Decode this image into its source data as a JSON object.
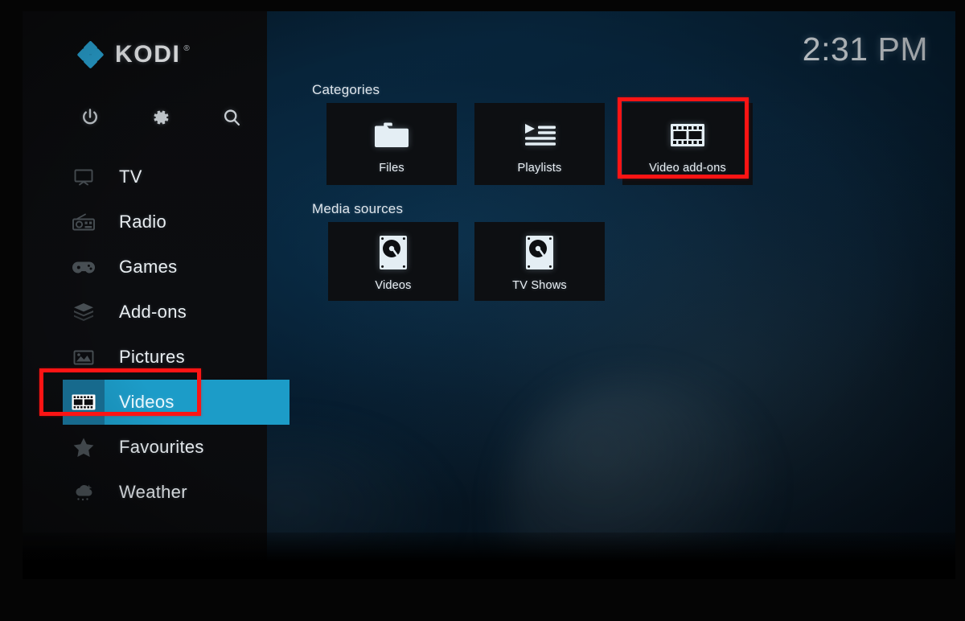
{
  "app": {
    "name": "KODI",
    "trademark": "®",
    "logo_color": "#2aa9db"
  },
  "clock": {
    "time": "2:31 PM"
  },
  "quick_actions": [
    {
      "name": "power-button",
      "icon": "power-icon",
      "label": "Power"
    },
    {
      "name": "settings-button",
      "icon": "gear-icon",
      "label": "Settings"
    },
    {
      "name": "search-button",
      "icon": "search-icon",
      "label": "Search"
    }
  ],
  "sidebar": {
    "items": [
      {
        "label": "TV",
        "icon": "tv-icon",
        "selected": false
      },
      {
        "label": "Radio",
        "icon": "radio-icon",
        "selected": false
      },
      {
        "label": "Games",
        "icon": "gamepad-icon",
        "selected": false
      },
      {
        "label": "Add-ons",
        "icon": "box-icon",
        "selected": false
      },
      {
        "label": "Pictures",
        "icon": "picture-icon",
        "selected": false
      },
      {
        "label": "Videos",
        "icon": "film-strip-icon",
        "selected": true
      },
      {
        "label": "Favourites",
        "icon": "star-icon",
        "selected": false
      },
      {
        "label": "Weather",
        "icon": "cloud-icon",
        "selected": false
      }
    ],
    "selected_index": 5,
    "highlight_color": "#1c9cc8",
    "highlight_icon_color": "#176a8d"
  },
  "main": {
    "categories": {
      "title": "Categories",
      "tiles": [
        {
          "label": "Files",
          "icon": "folder-icon",
          "highlighted": false
        },
        {
          "label": "Playlists",
          "icon": "playlist-icon",
          "highlighted": false
        },
        {
          "label": "Video add-ons",
          "icon": "film-strip-icon",
          "highlighted": true
        }
      ]
    },
    "media_sources": {
      "title": "Media sources",
      "tiles": [
        {
          "label": "Videos",
          "icon": "hard-drive-icon",
          "highlighted": false
        },
        {
          "label": "TV Shows",
          "icon": "hard-drive-icon",
          "highlighted": false
        }
      ]
    }
  },
  "annotations": {
    "color": "#fc1414",
    "boxes": [
      {
        "target": "sidebar-item-videos",
        "label": "Videos menu item highlight"
      },
      {
        "target": "tile-video-add-ons",
        "label": "Video add-ons tile highlight"
      }
    ]
  }
}
